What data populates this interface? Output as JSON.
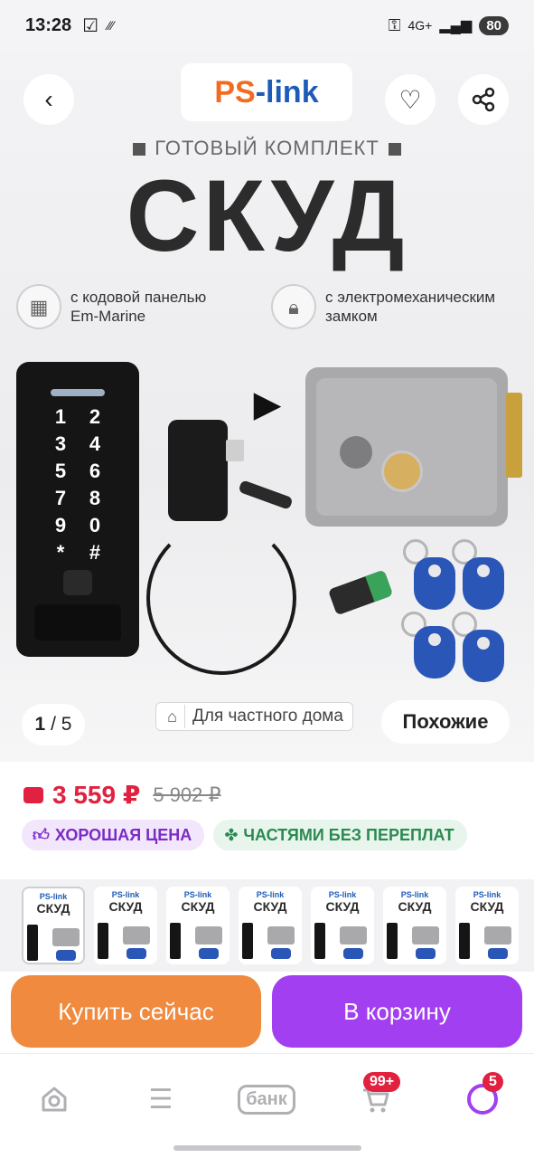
{
  "status_bar": {
    "time": "13:28",
    "network": "4G+",
    "battery": "80"
  },
  "header": {
    "brand_part1": "PS",
    "brand_part2": "-link"
  },
  "hero": {
    "kit_label": "ГОТОВЫЙ КОМПЛЕКТ",
    "title": "СКУД",
    "feature1_line1": "с кодовой панелью",
    "feature1_line2": "Em-Marine",
    "feature2_line1": "с электромеханическим",
    "feature2_line2": "замком",
    "keypad_keys": [
      "1",
      "2",
      "3",
      "4",
      "5",
      "6",
      "7",
      "8",
      "9",
      "0",
      "*",
      "#"
    ],
    "counter_current": "1",
    "counter_total": "5",
    "chip_label": "Для частного дома",
    "similar_label": "Похожие"
  },
  "price": {
    "current": "3 559 ₽",
    "old": "5 902 ₽",
    "badge_good": "ХОРОШАЯ ЦЕНА",
    "badge_parts": "ЧАСТЯМИ БЕЗ ПЕРЕПЛАТ"
  },
  "thumbnails": [
    {
      "brand": "PS-link",
      "title": "СКУД"
    },
    {
      "brand": "PS-link",
      "title": "СКУД"
    },
    {
      "brand": "PS-link",
      "title": "СКУД"
    },
    {
      "brand": "PS-link",
      "title": "СКУД"
    },
    {
      "brand": "PS-link",
      "title": "СКУД"
    },
    {
      "brand": "PS-link",
      "title": "СКУД"
    },
    {
      "brand": "PS-link",
      "title": "СКУД"
    }
  ],
  "actions": {
    "buy_now": "Купить сейчас",
    "to_cart": "В корзину"
  },
  "bottom_nav": {
    "bank_label": "банк",
    "cart_badge": "99+",
    "profile_badge": "5"
  },
  "colors": {
    "accent_price": "#e1213f",
    "buy_now": "#f08a3e",
    "to_cart": "#a23ff0"
  }
}
